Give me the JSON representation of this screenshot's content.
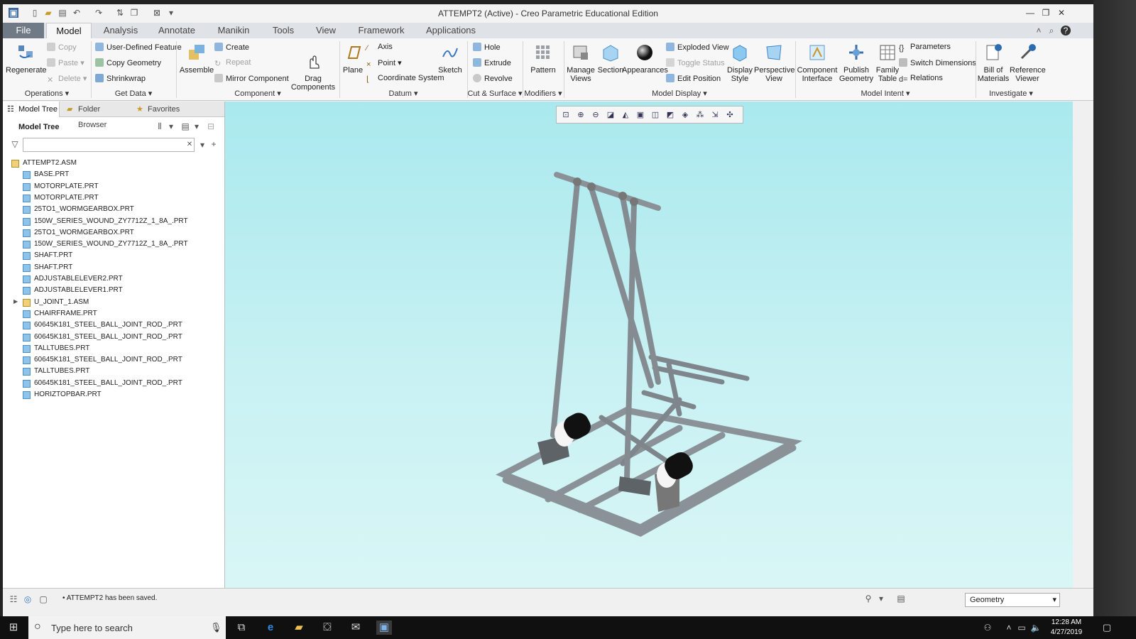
{
  "window": {
    "title": "ATTEMPT2 (Active) - Creo Parametric Educational Edition"
  },
  "ribbon_tabs": [
    "File",
    "Model",
    "Analysis",
    "Annotate",
    "Manikin",
    "Tools",
    "View",
    "Framework",
    "Applications"
  ],
  "ribbon": {
    "regenerate": "Regenerate",
    "copy": "Copy",
    "paste": "Paste",
    "delete": "Delete",
    "udf": "User-Defined Feature",
    "copy_geometry": "Copy Geometry",
    "shrinkwrap": "Shrinkwrap",
    "assemble": "Assemble",
    "create": "Create",
    "repeat": "Repeat",
    "mirror_component": "Mirror Component",
    "drag_components": "Drag\nComponents",
    "plane": "Plane",
    "axis": "Axis",
    "point": "Point",
    "coordinate_system": "Coordinate System",
    "sketch": "Sketch",
    "hole": "Hole",
    "extrude": "Extrude",
    "revolve": "Revolve",
    "pattern": "Pattern",
    "manage_views": "Manage Views",
    "section": "Section",
    "appearances": "Appearances",
    "exploded_view": "Exploded View",
    "toggle_status": "Toggle Status",
    "edit_position": "Edit Position",
    "display_style": "Display Style",
    "perspective_view": "Perspective View",
    "component_interface": "Component Interface",
    "publish_geometry": "Publish Geometry",
    "family_table": "Family Table",
    "parameters": "Parameters",
    "switch_dimensions": "Switch Dimensions",
    "relations": "Relations",
    "bill_of_materials": "Bill of Materials",
    "reference_viewer": "Reference Viewer",
    "groups": {
      "operations": "Operations",
      "get_data": "Get Data",
      "component": "Component",
      "datum": "Datum",
      "cut_surface": "Cut & Surface",
      "modifiers": "Modifiers",
      "model_display": "Model Display",
      "model_intent": "Model Intent",
      "investigate": "Investigate"
    }
  },
  "panel": {
    "tabs": [
      "Model Tree",
      "Folder Browser",
      "Favorites"
    ],
    "tree_title": "Model Tree",
    "search_placeholder": "",
    "items": [
      "ATTEMPT2.ASM",
      "BASE.PRT",
      "MOTORPLATE.PRT",
      "MOTORPLATE.PRT",
      "25TO1_WORMGEARBOX.PRT",
      "150W_SERIES_WOUND_ZY7712Z_1_8A_.PRT",
      "25TO1_WORMGEARBOX.PRT",
      "150W_SERIES_WOUND_ZY7712Z_1_8A_.PRT",
      "SHAFT.PRT",
      "SHAFT.PRT",
      "ADJUSTABLELEVER2.PRT",
      "ADJUSTABLELEVER1.PRT",
      "U_JOINT_1.ASM",
      "CHAIRFRAME.PRT",
      "60645K181_STEEL_BALL_JOINT_ROD_.PRT",
      "60645K181_STEEL_BALL_JOINT_ROD_.PRT",
      "TALLTUBES.PRT",
      "60645K181_STEEL_BALL_JOINT_ROD_.PRT",
      "TALLTUBES.PRT",
      "60645K181_STEEL_BALL_JOINT_ROD_.PRT",
      "HORIZTOPBAR.PRT"
    ]
  },
  "status": {
    "message": "ATTEMPT2 has been saved.",
    "filter": "Geometry"
  },
  "taskbar": {
    "search_text": "Type here to search",
    "time": "12:28 AM",
    "date": "4/27/2019"
  },
  "colors": {
    "viewport_top": "#a9e9ee",
    "viewport_bottom": "#d9f6f6",
    "file_tab": "#6f7a86",
    "model_gray": "#8c9399"
  }
}
